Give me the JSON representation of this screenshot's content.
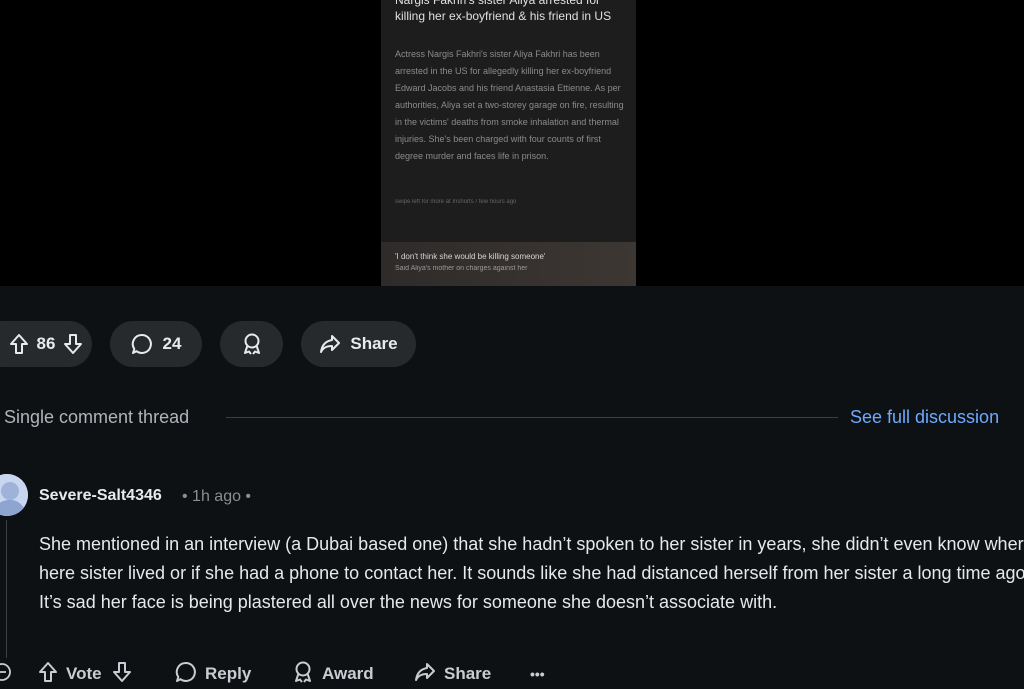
{
  "media": {
    "title": "Nargis Fakhri's sister Aliya arrested for killing her ex-boyfriend & his friend in US",
    "body": "Actress Nargis Fakhri's sister Aliya Fakhri has been arrested in the US for allegedly killing her ex-boyfriend Edward Jacobs and his friend Anastasia Ettienne. As per authorities, Aliya set a two-storey garage on fire, resulting in the victims' deaths from smoke inhalation and thermal injuries. She's been charged with four counts of first degree murder and faces life in prison.",
    "meta": "swipe left for more at Inshorts / few hours ago",
    "quote": "'I don't think she would be killing someone'",
    "quote_sub": "Said Aliya's mother on charges against her"
  },
  "post_actions": {
    "votes": "86",
    "comments": "24",
    "share_label": "Share",
    "icons": [
      "upvote-icon",
      "downvote-icon",
      "comment-icon",
      "award-icon",
      "share-icon"
    ]
  },
  "thread": {
    "label": "Single comment thread",
    "link": "See full discussion"
  },
  "comment": {
    "author": "Severe-Salt4346",
    "meta": "• 1h ago •",
    "text": "She mentioned in an interview (a Dubai based one) that she hadn’t spoken to her sister in years, she didn’t even know where here sister lived or if she had a phone to contact her. It sounds like she had distanced herself from her sister a long time ago. It’s sad her face is being plastered all over the news for someone she doesn’t associate with.",
    "actions": {
      "vote": "Vote",
      "reply": "Reply",
      "award": "Award",
      "share": "Share",
      "more": "•••"
    }
  },
  "colors": {
    "background": "#0e1113",
    "pill": "#272a2d",
    "link": "#6ea9ff"
  }
}
